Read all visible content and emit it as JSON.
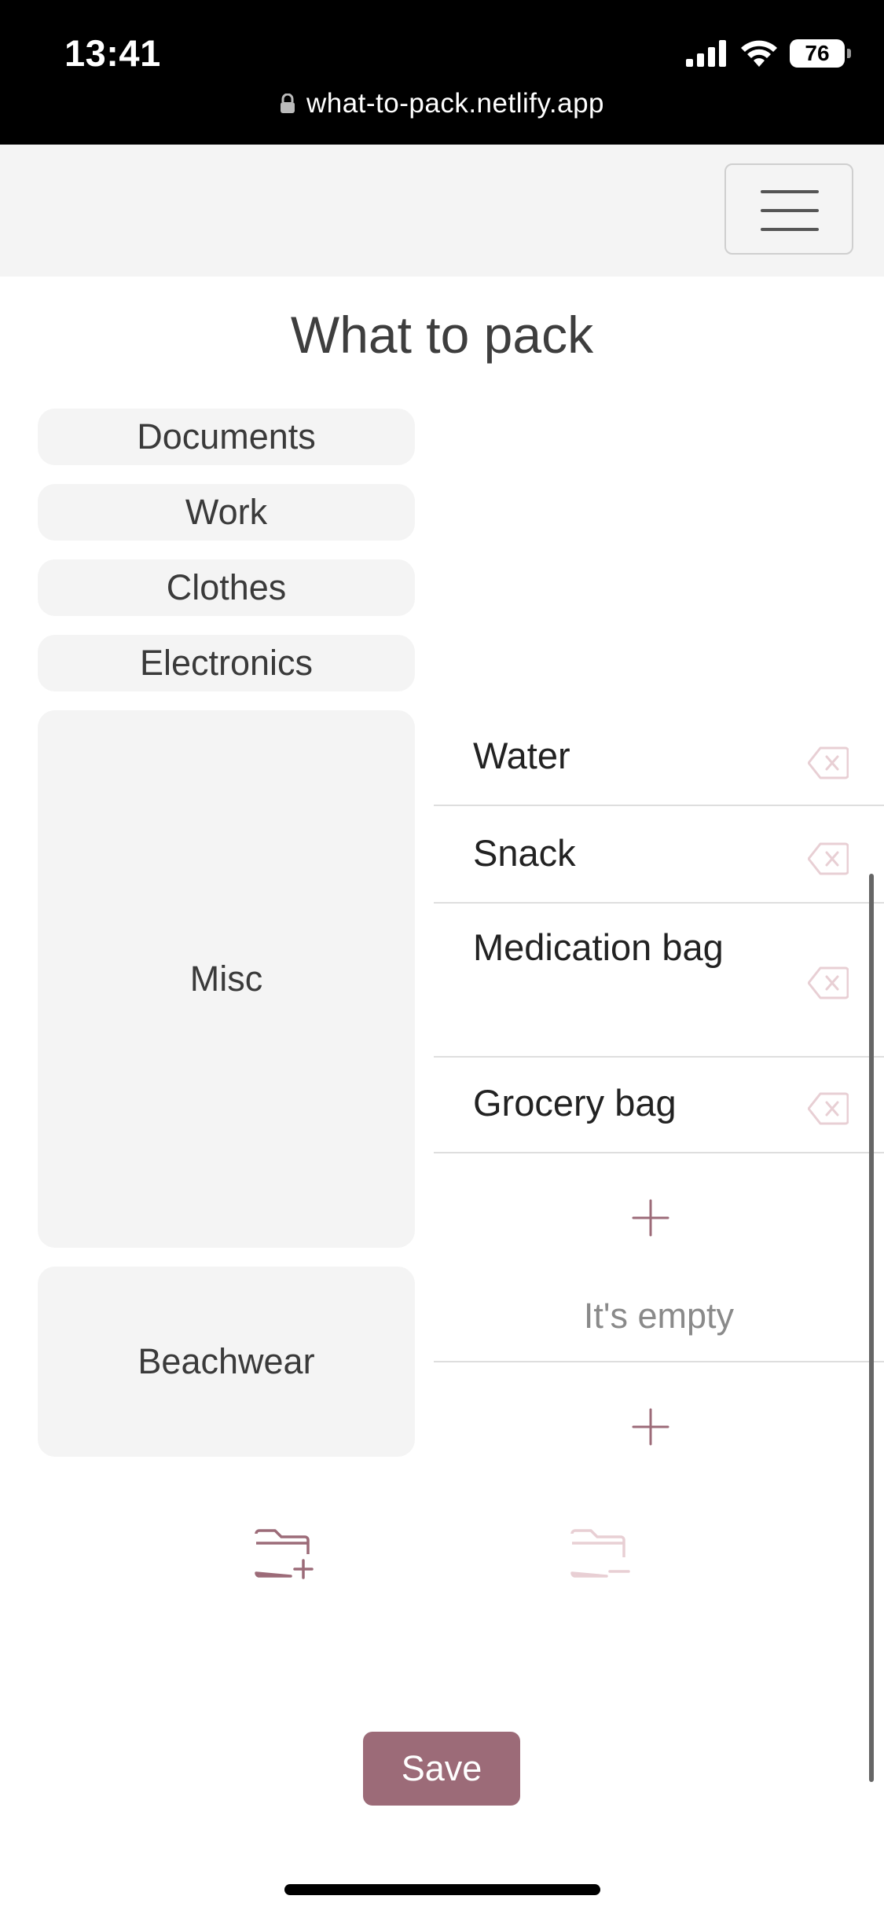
{
  "status_bar": {
    "time": "13:41",
    "battery": "76"
  },
  "browser": {
    "url": "what-to-pack.netlify.app"
  },
  "page": {
    "title": "What to pack"
  },
  "categories": [
    "Documents",
    "Work",
    "Clothes",
    "Electronics",
    "Misc",
    "Beachwear"
  ],
  "misc_items": [
    "Water",
    "Snack",
    "Medication bag",
    "Grocery bag"
  ],
  "beachwear_empty_text": "It's empty",
  "save_label": "Save",
  "colors": {
    "accent": "#9c6b78",
    "accent_light": "#e8cfd4",
    "panel": "#f4f4f4"
  }
}
